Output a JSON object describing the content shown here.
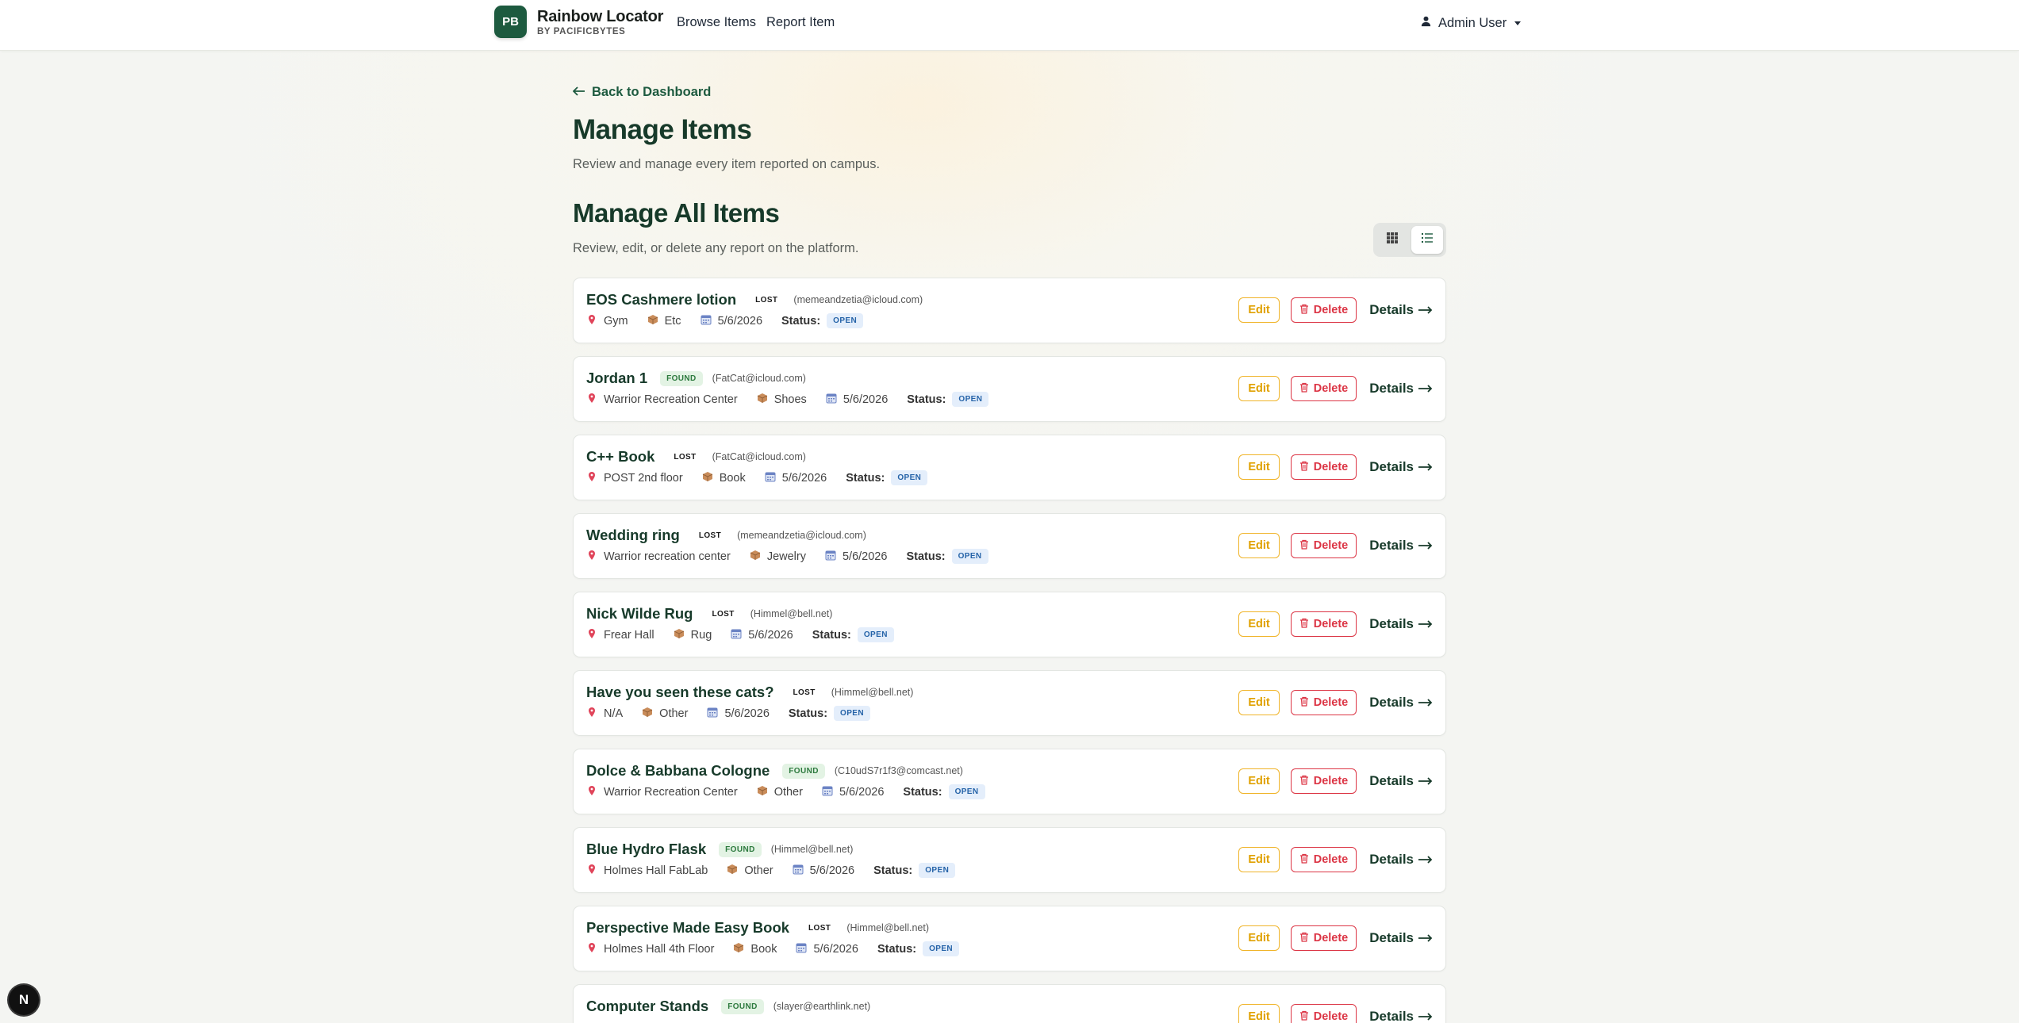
{
  "navbar": {
    "logo_text": "PB",
    "brand_title": "Rainbow Locator",
    "brand_subtitle": "BY PACIFICBYTES",
    "links": [
      "Browse Items",
      "Report Item"
    ],
    "user_label": "Admin User"
  },
  "header": {
    "back_label": "Back to Dashboard",
    "title": "Manage Items",
    "description": "Review and manage every item reported on campus.",
    "section_title": "Manage All Items",
    "section_description": "Review, edit, or delete any report on the platform."
  },
  "labels": {
    "status": "Status:",
    "edit": "Edit",
    "delete": "Delete",
    "details": "Details"
  },
  "view_toggle": {
    "active": "list"
  },
  "colors": {
    "brand": "#1d5a3f",
    "found": "#2d7a3e",
    "edit": "#f0b429",
    "delete": "#dc3545",
    "status": "#2563a8"
  },
  "items": [
    {
      "title": "EOS Cashmere lotion",
      "type": "LOST",
      "email": "(memeandzetia@icloud.com)",
      "location": "Gym",
      "category": "Etc",
      "date": "5/6/2026",
      "status": "OPEN"
    },
    {
      "title": "Jordan 1",
      "type": "FOUND",
      "email": "(FatCat@icloud.com)",
      "location": "Warrior Recreation Center",
      "category": "Shoes",
      "date": "5/6/2026",
      "status": "OPEN"
    },
    {
      "title": "C++ Book",
      "type": "LOST",
      "email": "(FatCat@icloud.com)",
      "location": "POST 2nd floor",
      "category": "Book",
      "date": "5/6/2026",
      "status": "OPEN"
    },
    {
      "title": "Wedding ring",
      "type": "LOST",
      "email": "(memeandzetia@icloud.com)",
      "location": "Warrior recreation center",
      "category": "Jewelry",
      "date": "5/6/2026",
      "status": "OPEN"
    },
    {
      "title": "Nick Wilde Rug",
      "type": "LOST",
      "email": "(Himmel@bell.net)",
      "location": "Frear Hall",
      "category": "Rug",
      "date": "5/6/2026",
      "status": "OPEN"
    },
    {
      "title": "Have you seen these cats?",
      "type": "LOST",
      "email": "(Himmel@bell.net)",
      "location": "N/A",
      "category": "Other",
      "date": "5/6/2026",
      "status": "OPEN"
    },
    {
      "title": "Dolce & Babbana Cologne",
      "type": "FOUND",
      "email": "(C10udS7r1f3@comcast.net)",
      "location": "Warrior Recreation Center",
      "category": "Other",
      "date": "5/6/2026",
      "status": "OPEN"
    },
    {
      "title": "Blue Hydro Flask",
      "type": "FOUND",
      "email": "(Himmel@bell.net)",
      "location": "Holmes Hall FabLab",
      "category": "Other",
      "date": "5/6/2026",
      "status": "OPEN"
    },
    {
      "title": "Perspective Made Easy Book",
      "type": "LOST",
      "email": "(Himmel@bell.net)",
      "location": "Holmes Hall 4th Floor",
      "category": "Book",
      "date": "5/6/2026",
      "status": "OPEN"
    },
    {
      "title": "Computer Stands",
      "type": "FOUND",
      "email": "(slayer@earthlink.net)",
      "location": "",
      "category": "",
      "date": "",
      "status": ""
    }
  ],
  "dev_badge": "N"
}
